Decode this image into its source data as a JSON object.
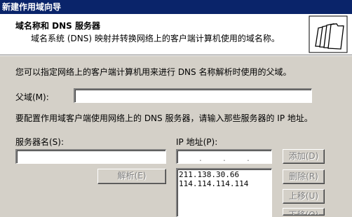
{
  "window": {
    "title": "新建作用域向导"
  },
  "header": {
    "title": "域名称和 DNS 服务器",
    "description": "域名系统 (DNS) 映射并转换网络上的客户端计算机使用的域名称。"
  },
  "body": {
    "intro": "您可以指定网络上的客户端计算机用来进行 DNS 名称解析时使用的父域。",
    "parent_domain_label": "父域(M):",
    "parent_domain_value": "",
    "config_text": "要配置作用域客户端使用网络上的 DNS 服务器，请输入那些服务器的 IP 地址。",
    "server_name_label": "服务器名(S):",
    "server_name_value": "",
    "ip_label": "IP 地址(P):",
    "ip_separators": [
      ".",
      ".",
      "."
    ],
    "resolve_button": "解析(E)",
    "dns_servers": [
      "211.138.30.66",
      "114.114.114.114"
    ],
    "buttons": {
      "add": "添加(D)",
      "delete": "删除(R)",
      "up": "上移(U)",
      "down": "下移(O)"
    }
  }
}
